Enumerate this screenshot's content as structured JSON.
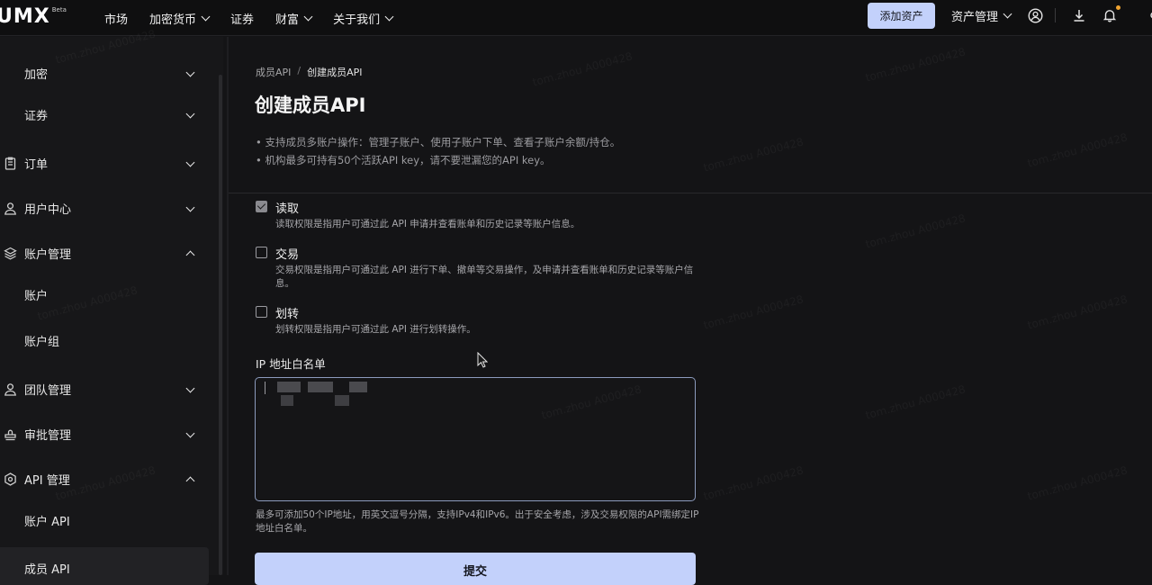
{
  "brand": {
    "logo": "UMX",
    "badge": "Beta"
  },
  "nav": {
    "items": [
      {
        "label": "市场",
        "dropdown": false
      },
      {
        "label": "加密货币",
        "dropdown": true
      },
      {
        "label": "证券",
        "dropdown": false
      },
      {
        "label": "财富",
        "dropdown": true
      },
      {
        "label": "关于我们",
        "dropdown": true
      }
    ]
  },
  "header": {
    "add_asset": "添加资产",
    "asset_mgmt": "资产管理"
  },
  "sidebar": {
    "items": [
      {
        "label": "加密",
        "icon": "none",
        "chevron": "down"
      },
      {
        "label": "证券",
        "icon": "none",
        "chevron": "down"
      },
      {
        "label": "订单",
        "icon": "clipboard-icon",
        "chevron": "down"
      },
      {
        "label": "用户中心",
        "icon": "user-icon",
        "chevron": "down"
      },
      {
        "label": "账户管理",
        "icon": "layers-icon",
        "chevron": "up"
      },
      {
        "label": "账户",
        "icon": "none",
        "chevron": "none"
      },
      {
        "label": "账户组",
        "icon": "none",
        "chevron": "none"
      },
      {
        "label": "团队管理",
        "icon": "team-icon",
        "chevron": "down"
      },
      {
        "label": "审批管理",
        "icon": "stamp-icon",
        "chevron": "down"
      },
      {
        "label": "API 管理",
        "icon": "api-icon",
        "chevron": "up"
      },
      {
        "label": "账户 API",
        "icon": "none",
        "chevron": "none"
      },
      {
        "label": "成员 API",
        "icon": "none",
        "chevron": "none",
        "active": true
      }
    ]
  },
  "breadcrumb": {
    "parent": "成员API",
    "separator": "/",
    "current": "创建成员API"
  },
  "page": {
    "title": "创建成员API",
    "notes": [
      "• 支持成员多账户操作：管理子账户、使用子账户下单、查看子账户余额/持仓。",
      "• 机构最多可持有50个活跃API key，请不要泄漏您的API key。"
    ]
  },
  "permissions": [
    {
      "title": "读取",
      "checked": true,
      "desc": "读取权限是指用户可通过此 API 申请并查看账单和历史记录等账户信息。"
    },
    {
      "title": "交易",
      "checked": false,
      "desc": "交易权限是指用户可通过此 API 进行下单、撤单等交易操作，及申请并查看账单和历史记录等账户信息。"
    },
    {
      "title": "划转",
      "checked": false,
      "desc": "划转权限是指用户可通过此 API 进行划转操作。"
    }
  ],
  "ip_whitelist": {
    "label": "IP 地址白名单",
    "hint": "最多可添加50个IP地址，用英文逗号分隔，支持IPv4和IPv6。出于安全考虑，涉及交易权限的API需绑定IP地址白名单。"
  },
  "submit_label": "提交",
  "watermark": "tom.zhou A000428",
  "colors": {
    "accent": "#c3d1fb",
    "background": "#141416",
    "sidebar": "#171719"
  }
}
